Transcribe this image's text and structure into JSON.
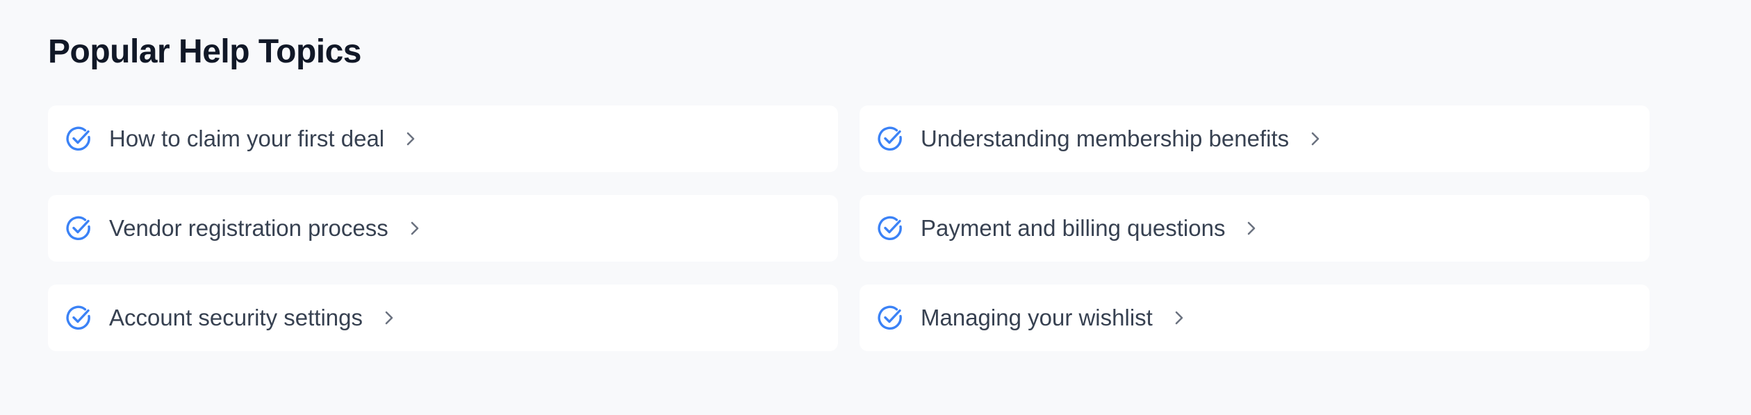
{
  "page": {
    "title": "Popular Help Topics"
  },
  "topics": [
    {
      "label": "How to claim your first deal",
      "icon": "check-circle-icon"
    },
    {
      "label": "Understanding membership benefits",
      "icon": "check-circle-icon"
    },
    {
      "label": "Vendor registration process",
      "icon": "check-circle-icon"
    },
    {
      "label": "Payment and billing questions",
      "icon": "check-circle-icon"
    },
    {
      "label": "Account security settings",
      "icon": "check-circle-icon"
    },
    {
      "label": "Managing your wishlist",
      "icon": "check-circle-icon"
    }
  ],
  "colors": {
    "background": "#f8f9fb",
    "card": "#ffffff",
    "accent": "#3b82f6",
    "title": "#111827",
    "text": "#374151",
    "chevron": "#6b7280"
  }
}
